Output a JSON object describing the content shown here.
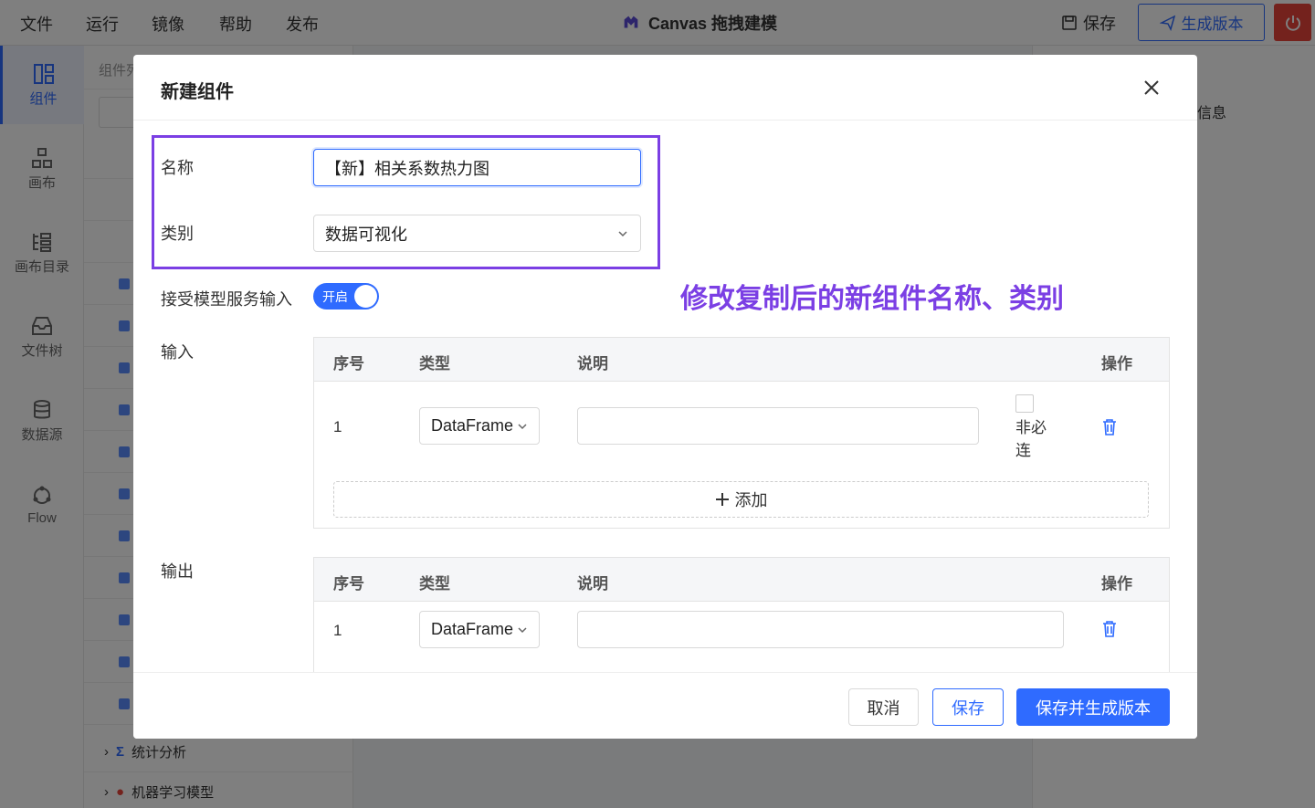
{
  "menu": [
    "文件",
    "运行",
    "镜像",
    "帮助",
    "发布"
  ],
  "app_title": "Canvas 拖拽建模",
  "top_actions": {
    "save": "保存",
    "generate_version": "生成版本"
  },
  "rail": [
    {
      "label": "组件",
      "icon": "component-icon",
      "active": true
    },
    {
      "label": "画布",
      "icon": "canvas-icon"
    },
    {
      "label": "画布目录",
      "icon": "canvas-catalog-icon"
    },
    {
      "label": "文件树",
      "icon": "file-tree-icon"
    },
    {
      "label": "数据源",
      "icon": "datasource-icon"
    },
    {
      "label": "Flow",
      "icon": "flow-icon"
    }
  ],
  "tree": {
    "header": "组件列",
    "bottom_items": [
      "统计分析",
      "机器学习模型"
    ]
  },
  "right_panel": {
    "title": "信息"
  },
  "modal": {
    "title": "新建组件",
    "name_label": "名称",
    "name_value": "【新】相关系数热力图",
    "category_label": "类别",
    "category_value": "数据可视化",
    "service_input_label": "接受模型服务输入",
    "toggle_text": "开启",
    "annotation": "修改复制后的新组件名称、类别",
    "input_label": "输入",
    "output_label": "输出",
    "columns": {
      "index": "序号",
      "type": "类型",
      "desc": "说明",
      "op": "操作"
    },
    "input_rows": [
      {
        "index": "1",
        "type": "DataFrame",
        "optional_label": "非必连"
      }
    ],
    "output_rows": [
      {
        "index": "1",
        "type": "DataFrame"
      }
    ],
    "add_label": "添加",
    "buttons": {
      "cancel": "取消",
      "save": "保存",
      "save_generate": "保存并生成版本"
    }
  },
  "colors": {
    "accent": "#2f6bff",
    "annotation": "#7b3fe4",
    "danger": "#e8443a"
  }
}
